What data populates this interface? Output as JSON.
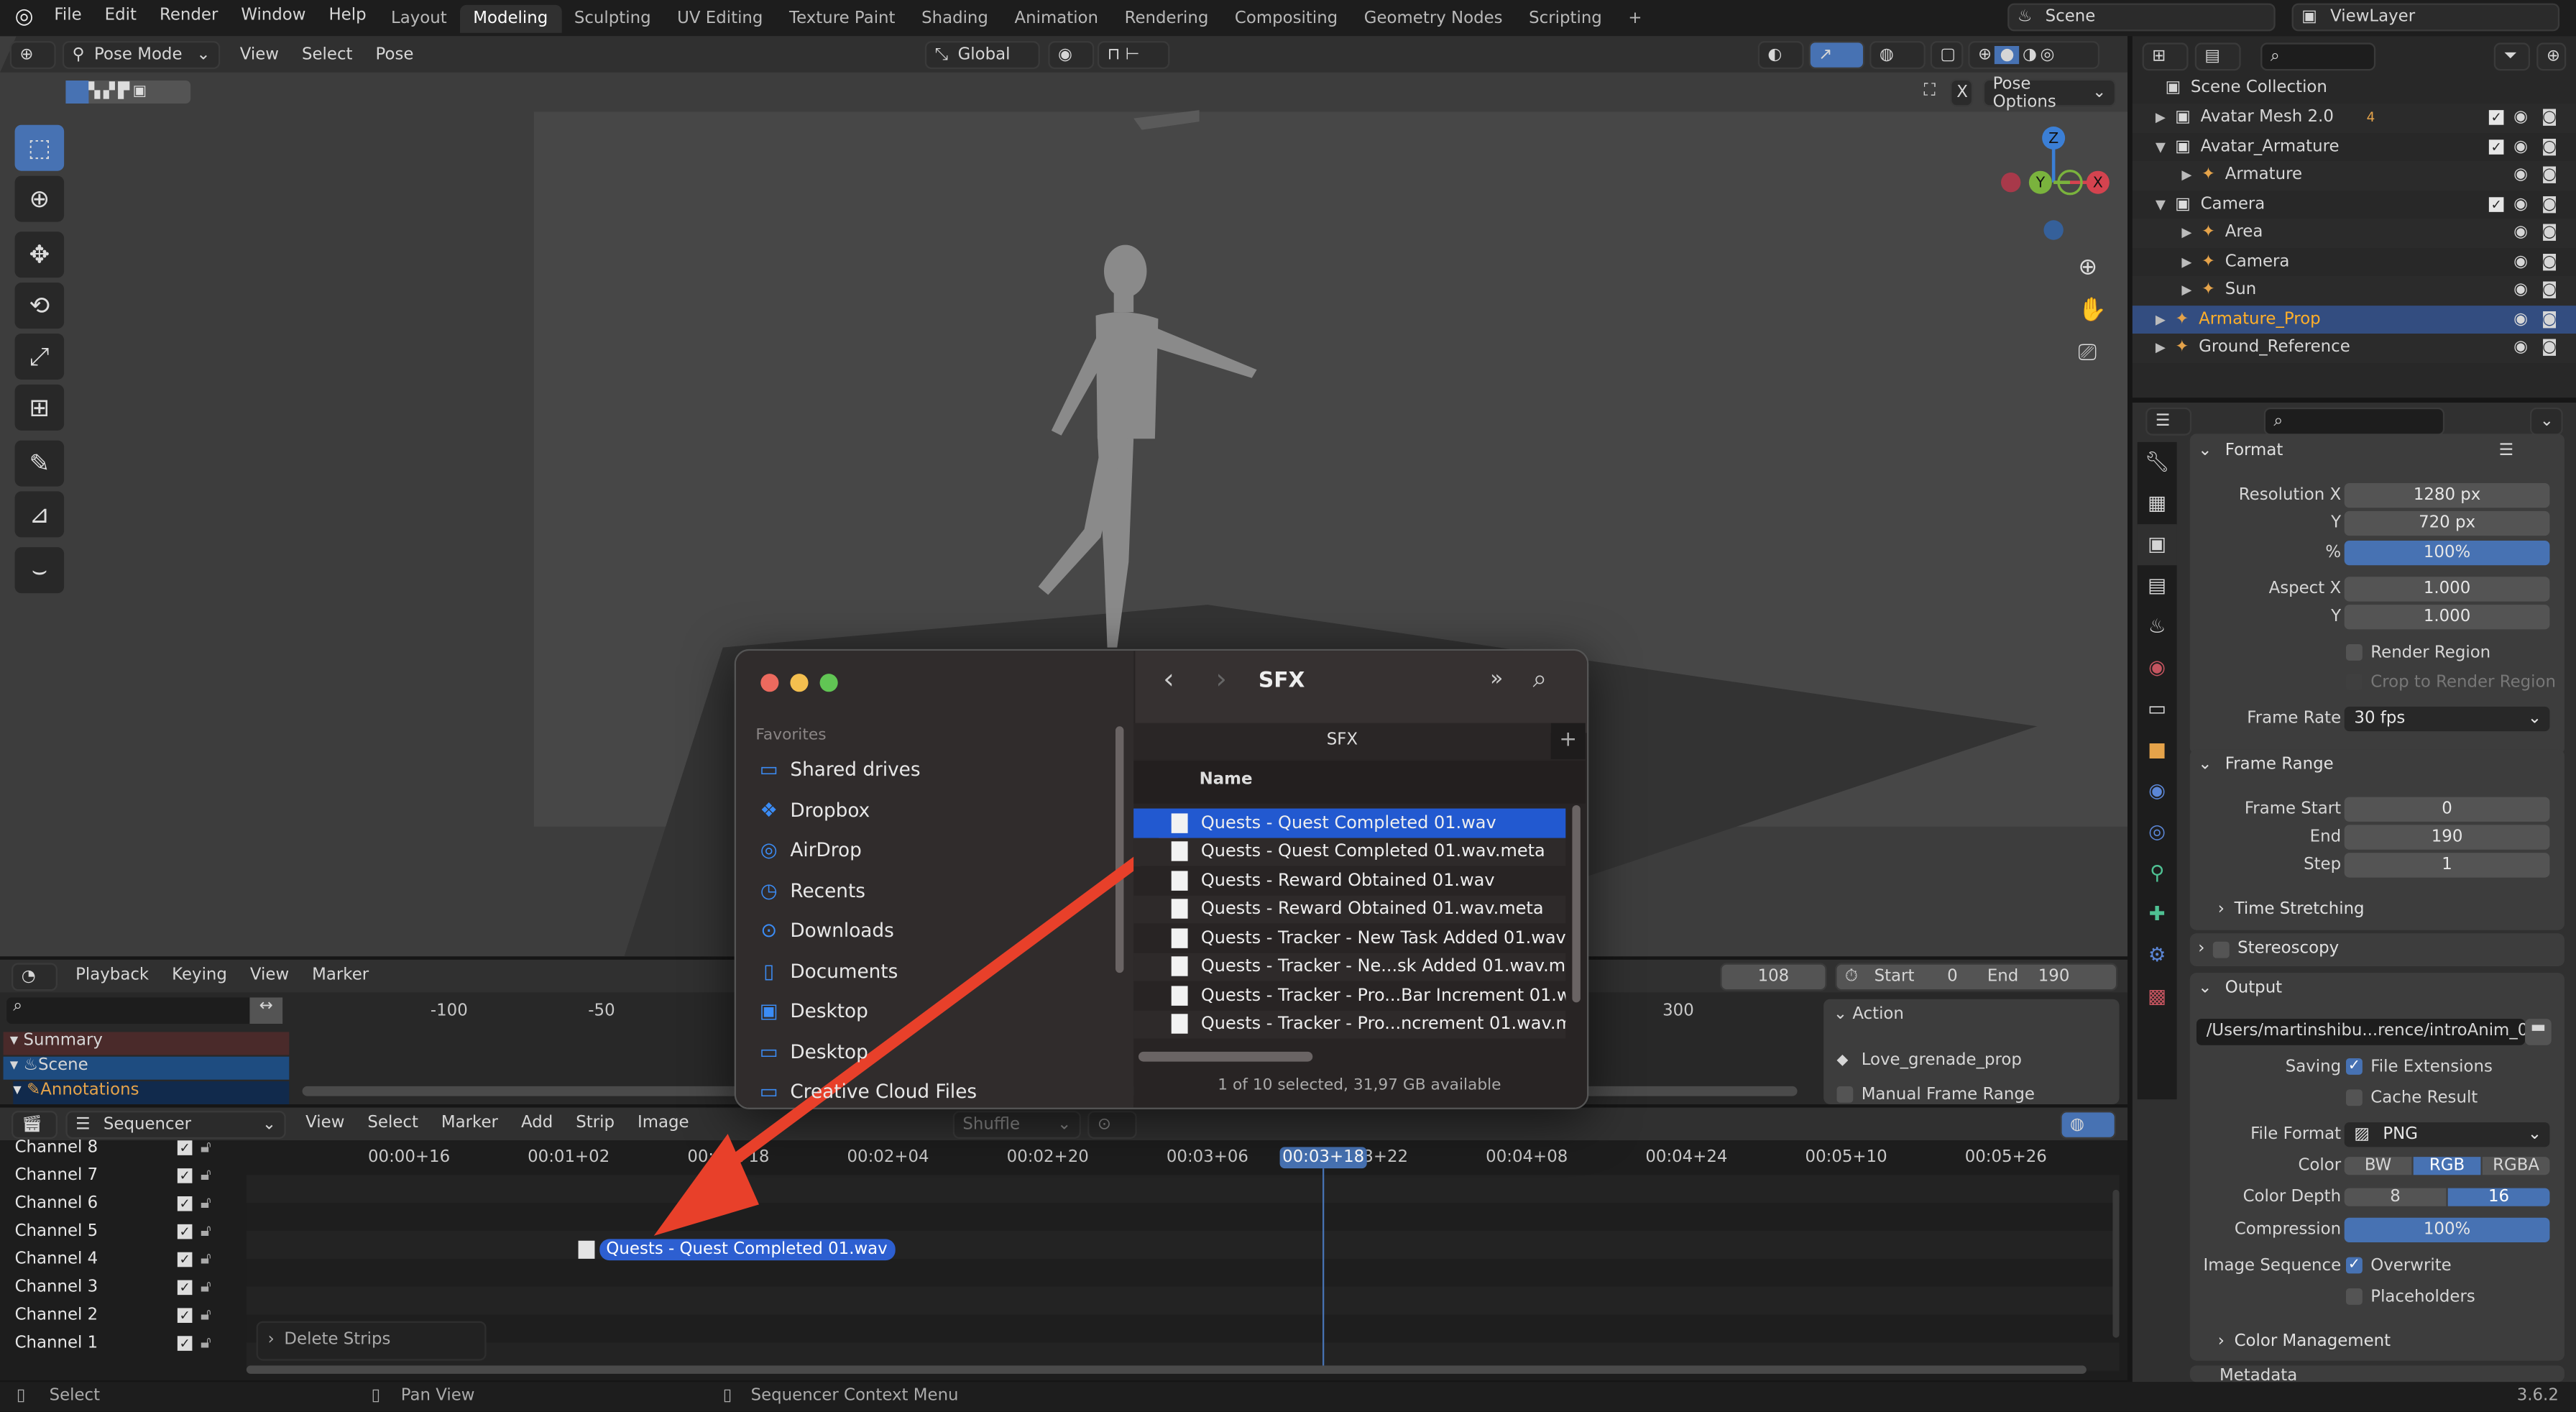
{
  "topbar": {
    "menus": [
      "File",
      "Edit",
      "Render",
      "Window",
      "Help"
    ],
    "workspaces": [
      "Layout",
      "Modeling",
      "Sculpting",
      "UV Editing",
      "Texture Paint",
      "Shading",
      "Animation",
      "Rendering",
      "Compositing",
      "Geometry Nodes",
      "Scripting",
      "+"
    ],
    "active_workspace": "Modeling",
    "scene": "Scene",
    "view_layer": "ViewLayer"
  },
  "viewport": {
    "mode": "Pose Mode",
    "menus": [
      "View",
      "Select",
      "Pose"
    ],
    "orientation": "Global",
    "pose_options": "Pose Options",
    "gizmo_axes": [
      "Z",
      "Y",
      "X"
    ],
    "tools": [
      "select-box-icon",
      "cursor-icon",
      "move-icon",
      "rotate-icon",
      "scale-icon",
      "transform-icon",
      "annotate-icon",
      "measure-icon",
      "pose-relax-icon"
    ]
  },
  "outliner": {
    "root": "Scene Collection",
    "items": [
      {
        "label": "Avatar Mesh 2.0",
        "badge": "4",
        "depth": 0,
        "expanded": false,
        "checkbox": true
      },
      {
        "label": "Avatar_Armature",
        "depth": 0,
        "expanded": true,
        "checkbox": true
      },
      {
        "label": "Armature",
        "depth": 1,
        "expanded": false,
        "checkbox": false
      },
      {
        "label": "Camera",
        "depth": 0,
        "expanded": true,
        "checkbox": true
      },
      {
        "label": "Area",
        "depth": 1,
        "expanded": false,
        "checkbox": false
      },
      {
        "label": "Camera",
        "depth": 1,
        "expanded": false,
        "checkbox": false
      },
      {
        "label": "Sun",
        "depth": 1,
        "expanded": false,
        "checkbox": false
      },
      {
        "label": "Armature_Prop",
        "depth": 0,
        "expanded": false,
        "checkbox": false,
        "selected": true
      },
      {
        "label": "Ground_Reference",
        "depth": 0,
        "expanded": false,
        "checkbox": false
      }
    ]
  },
  "properties": {
    "format": {
      "title": "Format",
      "resolution_x_label": "Resolution X",
      "resolution_x": "1280 px",
      "y_label": "Y",
      "resolution_y": "720 px",
      "percent_label": "%",
      "percent": "100%",
      "aspect_x_label": "Aspect X",
      "aspect_x": "1.000",
      "aspect_y_label": "Y",
      "aspect_y": "1.000",
      "render_region": "Render Region",
      "crop": "Crop to Render Region",
      "frame_rate_label": "Frame Rate",
      "frame_rate": "30 fps"
    },
    "frame_range": {
      "title": "Frame Range",
      "start_label": "Frame Start",
      "start": "0",
      "end_label": "End",
      "end": "190",
      "step_label": "Step",
      "step": "1",
      "time_stretching": "Time Stretching"
    },
    "stereoscopy": "Stereoscopy",
    "output": {
      "title": "Output",
      "path": "/Users/martinshibu...rence/introAnim_03",
      "saving_label": "Saving",
      "file_extensions": "File Extensions",
      "cache_result": "Cache Result",
      "file_format_label": "File Format",
      "file_format": "PNG",
      "color_label": "Color",
      "color_options": [
        "BW",
        "RGB",
        "RGBA"
      ],
      "color_selected": "RGB",
      "depth_label": "Color Depth",
      "depth_options": [
        "8",
        "16"
      ],
      "depth_selected": "16",
      "compression_label": "Compression",
      "compression": "100%",
      "image_sequence_label": "Image Sequence",
      "overwrite": "Overwrite",
      "placeholders": "Placeholders",
      "color_management": "Color Management"
    },
    "metadata": "Metadata"
  },
  "timeline": {
    "menus": [
      "Playback",
      "Keying",
      "View",
      "Marker"
    ],
    "current_frame": "108",
    "start_label": "Start",
    "start": "0",
    "end_label": "End",
    "end": "190",
    "ticks": [
      "-100",
      "-50",
      "300"
    ],
    "channels": [
      "Summary",
      "Scene",
      "Annotations"
    ],
    "action_title": "Action",
    "action_name": "Love_grenade_prop",
    "manual_frame_range": "Manual Frame Range"
  },
  "sequencer": {
    "editor": "Sequencer",
    "menus": [
      "View",
      "Select",
      "Marker",
      "Add",
      "Strip",
      "Image"
    ],
    "overlap_mode": "Shuffle",
    "ticks": [
      "00:00+16",
      "00:01+02",
      "00:01+18",
      "00:02+04",
      "00:02+20",
      "00:03+06",
      "00:03+22",
      "00:04+08",
      "00:04+24",
      "00:05+10",
      "00:05+26"
    ],
    "current_time": "00:03+18",
    "channels": [
      "Channel 8",
      "Channel 7",
      "Channel 6",
      "Channel 5",
      "Channel 4",
      "Channel 3",
      "Channel 2",
      "Channel 1"
    ],
    "strip": "Quests - Quest Completed 01.wav",
    "last_operator": "Delete Strips"
  },
  "finder": {
    "favorites_label": "Favorites",
    "favorites": [
      {
        "label": "Shared drives",
        "icon": "folder-icon"
      },
      {
        "label": "Dropbox",
        "icon": "dropbox-icon"
      },
      {
        "label": "AirDrop",
        "icon": "airdrop-icon"
      },
      {
        "label": "Recents",
        "icon": "clock-icon"
      },
      {
        "label": "Downloads",
        "icon": "download-icon"
      },
      {
        "label": "Documents",
        "icon": "document-icon"
      },
      {
        "label": "Desktop",
        "icon": "desktop-icon"
      },
      {
        "label": "Desktop",
        "icon": "folder-icon"
      },
      {
        "label": "Creative Cloud Files",
        "icon": "folder-icon"
      }
    ],
    "title": "SFX",
    "tab": "SFX",
    "column_name": "Name",
    "files": [
      "Quests - Quest Completed 01.wav",
      "Quests - Quest Completed 01.wav.meta",
      "Quests - Reward Obtained 01.wav",
      "Quests - Reward Obtained 01.wav.meta",
      "Quests - Tracker - New Task Added 01.wav",
      "Quests - Tracker - Ne...sk Added 01.wav.meta",
      "Quests - Tracker - Pro...Bar Increment 01.wav",
      "Quests - Tracker - Pro...ncrement 01.wav.meta"
    ],
    "selected_index": 0,
    "status": "1 of 10 selected, 31,97 GB available"
  },
  "statusbar": {
    "select": "Select",
    "pan": "Pan View",
    "context": "Sequencer Context Menu",
    "version": "3.6.2"
  },
  "colors": {
    "accent": "#4772b3",
    "selected_file": "#2259d0",
    "arrow": "#e8402a",
    "object_orange": "#e5a34a"
  }
}
